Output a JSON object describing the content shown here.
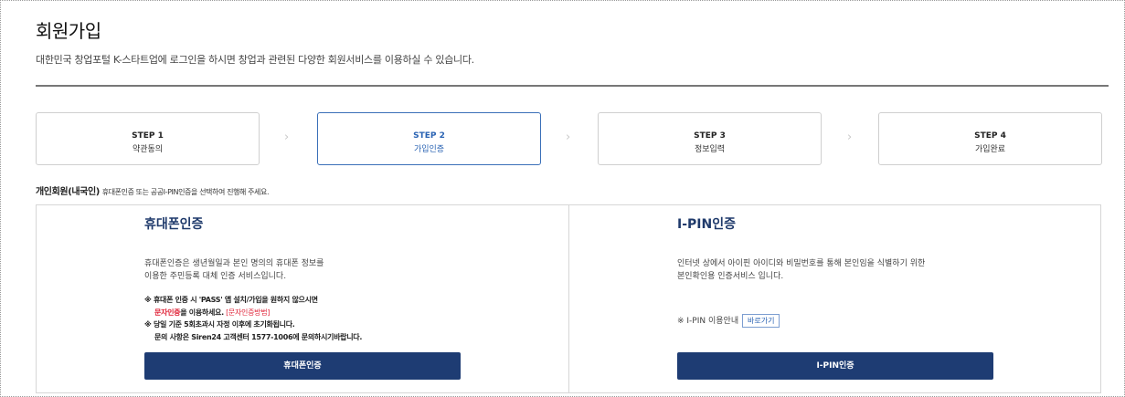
{
  "page": {
    "title": "회원가입",
    "description": "대한민국 창업포털 K-스타트업에 로그인을 하시면 창업과 관련된 다양한 회원서비스를 이용하실 수 있습니다."
  },
  "steps": [
    {
      "num": "STEP 1",
      "label": "약관동의",
      "active": false
    },
    {
      "num": "STEP 2",
      "label": "가입인증",
      "active": true
    },
    {
      "num": "STEP 3",
      "label": "정보입력",
      "active": false
    },
    {
      "num": "STEP 4",
      "label": "가입완료",
      "active": false
    }
  ],
  "member_note": {
    "type": "개인회원(내국인)",
    "text": "휴대폰인증 또는 공공I-PIN인증을 선택하여 진행해 주세요."
  },
  "phone": {
    "title": "휴대폰인증",
    "desc_line1": "휴대폰인증은 생년월일과 본인 명의의 휴대폰 정보를",
    "desc_line2": "이용한 주민등록 대체 인증 서비스입니다.",
    "note1": "※ 휴대폰 인증 시 'PASS' 앱 설치/가입을 원하지 않으시면",
    "note2_red": "문자인증",
    "note2_rest": "을 이용하세요.",
    "note2_link": "[문자인증방법]",
    "note3": "※ 당일 기준 5회초과시 자정 이후에 초기화됩니다.",
    "note4": "문의 사항은 Siren24 고객센터 1577-1006에 문의하시기바랍니다.",
    "button": "휴대폰인증"
  },
  "ipin": {
    "title": "I-PIN인증",
    "desc_line1": "인터넷 상에서 아이핀 아이디와 비밀번호를 통해 본인임을 식별하기 위한",
    "desc_line2": "본인확인용 인증서비스 입니다.",
    "guide_text": "※ I-PIN 이용안내",
    "guide_button": "바로가기",
    "button": "I-PIN인증"
  },
  "colors": {
    "primary_button": "#1e3c73",
    "active_step": "#2a63b3",
    "highlight_red": "#e0253a"
  }
}
